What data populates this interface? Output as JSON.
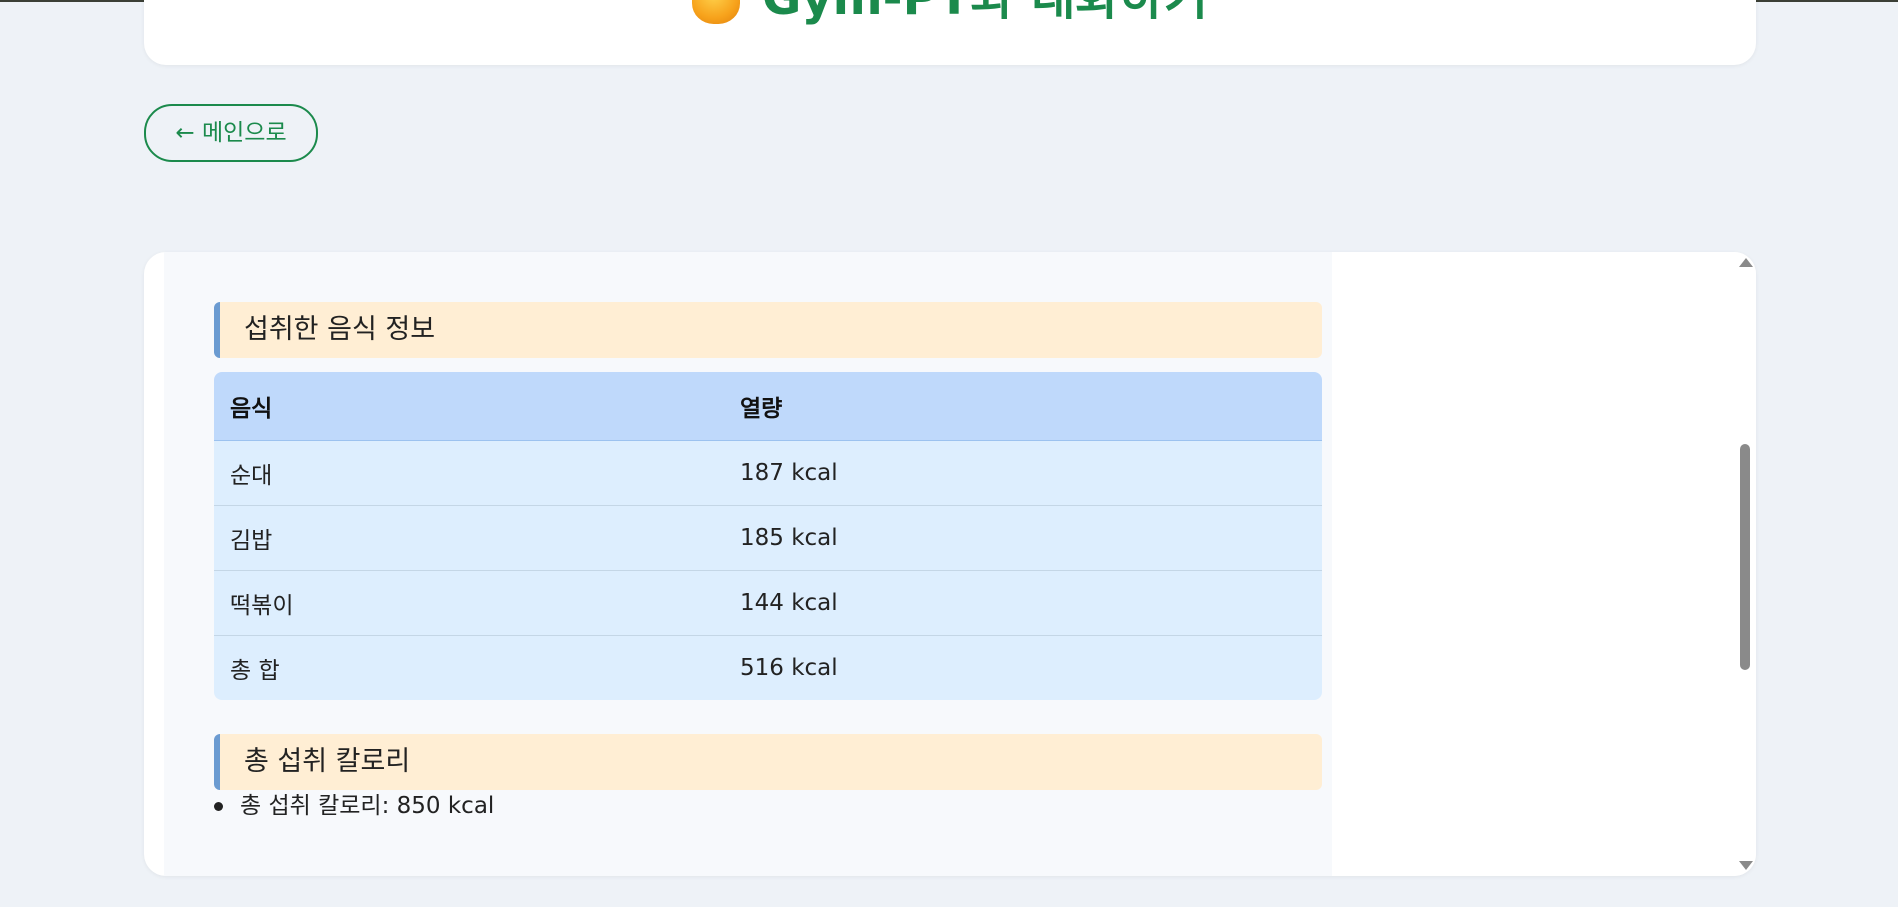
{
  "header": {
    "title": "Gym-PT와 대화하기",
    "icon": "fire-emoji-icon"
  },
  "nav": {
    "back_label": "← 메인으로"
  },
  "food_section": {
    "heading": "섭취한 음식 정보",
    "columns": [
      "음식",
      "열량"
    ],
    "rows": [
      {
        "food": "순대",
        "calories": "187 kcal"
      },
      {
        "food": "김밥",
        "calories": "185 kcal"
      },
      {
        "food": "떡볶이",
        "calories": "144 kcal"
      },
      {
        "food": "총 합",
        "calories": "516 kcal"
      }
    ]
  },
  "total_section": {
    "heading": "총 섭취 칼로리",
    "items": [
      "총 섭취 칼로리: 850 kcal"
    ]
  },
  "colors": {
    "accent": "#1b8a4c",
    "heading_bg": "#ffeed4",
    "heading_border": "#6b9bd1",
    "table_header_bg": "#bfd9fb",
    "table_row_bg": "#ddeefe",
    "page_bg": "#eef2f7"
  },
  "scroll": {
    "position_fraction": 0.4
  }
}
